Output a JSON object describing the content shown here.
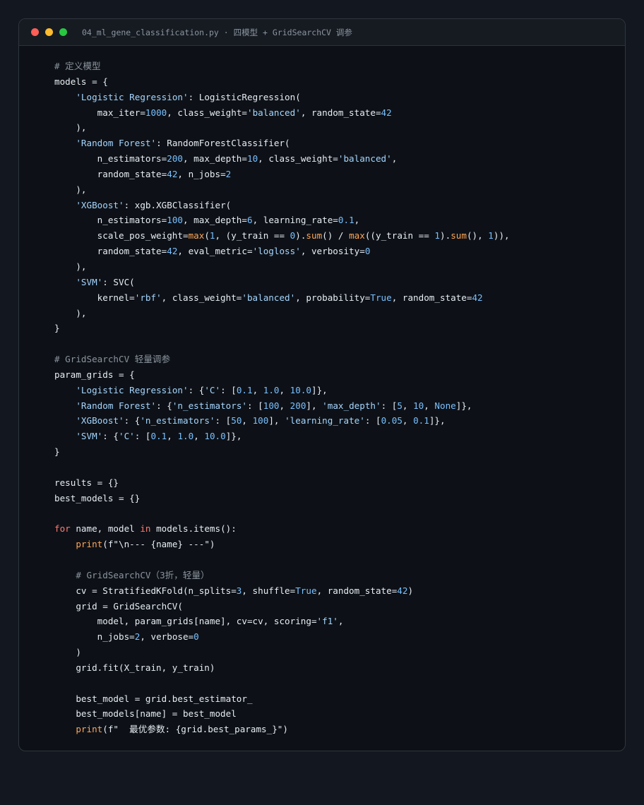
{
  "window": {
    "title": "04_ml_gene_classification.py · 四模型 + GridSearchCV 调参"
  },
  "colors": {
    "page_background": "#131720",
    "editor_background": "#0d1117",
    "titlebar_background": "#161b22",
    "comment": "#8b949e",
    "string": "#a5d6ff",
    "number": "#79c0ff",
    "keyword": "#ff7b72",
    "builtin_function": "#ffa657",
    "default_text": "#e6edf3",
    "close_dot": "#ff5f57",
    "minimize_dot": "#febc2e",
    "zoom_dot": "#28c840"
  },
  "code_lines": [
    [
      [
        "com",
        "# 定义模型"
      ]
    ],
    [
      [
        "def",
        "models = {"
      ]
    ],
    [
      [
        "def",
        "    "
      ],
      [
        "str",
        "'Logistic Regression'"
      ],
      [
        "def",
        ": LogisticRegression("
      ]
    ],
    [
      [
        "def",
        "        max_iter="
      ],
      [
        "num",
        "1000"
      ],
      [
        "def",
        ", class_weight="
      ],
      [
        "str",
        "'balanced'"
      ],
      [
        "def",
        ", random_state="
      ],
      [
        "num",
        "42"
      ]
    ],
    [
      [
        "def",
        "    ),"
      ]
    ],
    [
      [
        "def",
        "    "
      ],
      [
        "str",
        "'Random Forest'"
      ],
      [
        "def",
        ": RandomForestClassifier("
      ]
    ],
    [
      [
        "def",
        "        n_estimators="
      ],
      [
        "num",
        "200"
      ],
      [
        "def",
        ", max_depth="
      ],
      [
        "num",
        "10"
      ],
      [
        "def",
        ", class_weight="
      ],
      [
        "str",
        "'balanced'"
      ],
      [
        "def",
        ","
      ]
    ],
    [
      [
        "def",
        "        random_state="
      ],
      [
        "num",
        "42"
      ],
      [
        "def",
        ", n_jobs="
      ],
      [
        "num",
        "2"
      ]
    ],
    [
      [
        "def",
        "    ),"
      ]
    ],
    [
      [
        "def",
        "    "
      ],
      [
        "str",
        "'XGBoost'"
      ],
      [
        "def",
        ": xgb.XGBClassifier("
      ]
    ],
    [
      [
        "def",
        "        n_estimators="
      ],
      [
        "num",
        "100"
      ],
      [
        "def",
        ", max_depth="
      ],
      [
        "num",
        "6"
      ],
      [
        "def",
        ", learning_rate="
      ],
      [
        "num",
        "0.1"
      ],
      [
        "def",
        ","
      ]
    ],
    [
      [
        "def",
        "        scale_pos_weight="
      ],
      [
        "fn",
        "max"
      ],
      [
        "def",
        "("
      ],
      [
        "num",
        "1"
      ],
      [
        "def",
        ", (y_train == "
      ],
      [
        "num",
        "0"
      ],
      [
        "def",
        ")."
      ],
      [
        "fn",
        "sum"
      ],
      [
        "def",
        "() / "
      ],
      [
        "fn",
        "max"
      ],
      [
        "def",
        "((y_train == "
      ],
      [
        "num",
        "1"
      ],
      [
        "def",
        ")."
      ],
      [
        "fn",
        "sum"
      ],
      [
        "def",
        "(), "
      ],
      [
        "num",
        "1"
      ],
      [
        "def",
        ")),"
      ]
    ],
    [
      [
        "def",
        "        random_state="
      ],
      [
        "num",
        "42"
      ],
      [
        "def",
        ", eval_metric="
      ],
      [
        "str",
        "'logloss'"
      ],
      [
        "def",
        ", verbosity="
      ],
      [
        "num",
        "0"
      ]
    ],
    [
      [
        "def",
        "    ),"
      ]
    ],
    [
      [
        "def",
        "    "
      ],
      [
        "str",
        "'SVM'"
      ],
      [
        "def",
        ": SVC("
      ]
    ],
    [
      [
        "def",
        "        kernel="
      ],
      [
        "str",
        "'rbf'"
      ],
      [
        "def",
        ", class_weight="
      ],
      [
        "str",
        "'balanced'"
      ],
      [
        "def",
        ", probability="
      ],
      [
        "num",
        "True"
      ],
      [
        "def",
        ", random_state="
      ],
      [
        "num",
        "42"
      ]
    ],
    [
      [
        "def",
        "    ),"
      ]
    ],
    [
      [
        "def",
        "}"
      ]
    ],
    [],
    [
      [
        "com",
        "# GridSearchCV 轻量调参"
      ]
    ],
    [
      [
        "def",
        "param_grids = {"
      ]
    ],
    [
      [
        "def",
        "    "
      ],
      [
        "str",
        "'Logistic Regression'"
      ],
      [
        "def",
        ": {"
      ],
      [
        "str",
        "'C'"
      ],
      [
        "def",
        ": ["
      ],
      [
        "num",
        "0.1"
      ],
      [
        "def",
        ", "
      ],
      [
        "num",
        "1.0"
      ],
      [
        "def",
        ", "
      ],
      [
        "num",
        "10.0"
      ],
      [
        "def",
        "]},"
      ]
    ],
    [
      [
        "def",
        "    "
      ],
      [
        "str",
        "'Random Forest'"
      ],
      [
        "def",
        ": {"
      ],
      [
        "str",
        "'n_estimators'"
      ],
      [
        "def",
        ": ["
      ],
      [
        "num",
        "100"
      ],
      [
        "def",
        ", "
      ],
      [
        "num",
        "200"
      ],
      [
        "def",
        "], "
      ],
      [
        "str",
        "'max_depth'"
      ],
      [
        "def",
        ": ["
      ],
      [
        "num",
        "5"
      ],
      [
        "def",
        ", "
      ],
      [
        "num",
        "10"
      ],
      [
        "def",
        ", "
      ],
      [
        "num",
        "None"
      ],
      [
        "def",
        "]},"
      ]
    ],
    [
      [
        "def",
        "    "
      ],
      [
        "str",
        "'XGBoost'"
      ],
      [
        "def",
        ": {"
      ],
      [
        "str",
        "'n_estimators'"
      ],
      [
        "def",
        ": ["
      ],
      [
        "num",
        "50"
      ],
      [
        "def",
        ", "
      ],
      [
        "num",
        "100"
      ],
      [
        "def",
        "], "
      ],
      [
        "str",
        "'learning_rate'"
      ],
      [
        "def",
        ": ["
      ],
      [
        "num",
        "0.05"
      ],
      [
        "def",
        ", "
      ],
      [
        "num",
        "0.1"
      ],
      [
        "def",
        "]},"
      ]
    ],
    [
      [
        "def",
        "    "
      ],
      [
        "str",
        "'SVM'"
      ],
      [
        "def",
        ": {"
      ],
      [
        "str",
        "'C'"
      ],
      [
        "def",
        ": ["
      ],
      [
        "num",
        "0.1"
      ],
      [
        "def",
        ", "
      ],
      [
        "num",
        "1.0"
      ],
      [
        "def",
        ", "
      ],
      [
        "num",
        "10.0"
      ],
      [
        "def",
        "]},"
      ]
    ],
    [
      [
        "def",
        "}"
      ]
    ],
    [],
    [
      [
        "def",
        "results = {}"
      ]
    ],
    [
      [
        "def",
        "best_models = {}"
      ]
    ],
    [],
    [
      [
        "kw",
        "for"
      ],
      [
        "def",
        " name, model "
      ],
      [
        "kw",
        "in"
      ],
      [
        "def",
        " models.items():"
      ]
    ],
    [
      [
        "def",
        "    "
      ],
      [
        "fn",
        "print"
      ],
      [
        "def",
        "(f\"\\n--- {name} ---\")"
      ]
    ],
    [],
    [
      [
        "def",
        "    "
      ],
      [
        "com",
        "# GridSearchCV（3折，轻量）"
      ]
    ],
    [
      [
        "def",
        "    cv = StratifiedKFold(n_splits="
      ],
      [
        "num",
        "3"
      ],
      [
        "def",
        ", shuffle="
      ],
      [
        "num",
        "True"
      ],
      [
        "def",
        ", random_state="
      ],
      [
        "num",
        "42"
      ],
      [
        "def",
        ")"
      ]
    ],
    [
      [
        "def",
        "    grid = GridSearchCV("
      ]
    ],
    [
      [
        "def",
        "        model, param_grids[name], cv=cv, scoring="
      ],
      [
        "str",
        "'f1'"
      ],
      [
        "def",
        ","
      ]
    ],
    [
      [
        "def",
        "        n_jobs="
      ],
      [
        "num",
        "2"
      ],
      [
        "def",
        ", verbose="
      ],
      [
        "num",
        "0"
      ]
    ],
    [
      [
        "def",
        "    )"
      ]
    ],
    [
      [
        "def",
        "    grid.fit(X_train, y_train)"
      ]
    ],
    [],
    [
      [
        "def",
        "    best_model = grid.best_estimator_"
      ]
    ],
    [
      [
        "def",
        "    best_models[name] = best_model"
      ]
    ],
    [
      [
        "def",
        "    "
      ],
      [
        "fn",
        "print"
      ],
      [
        "def",
        "(f\"  最优参数: {grid.best_params_}\")"
      ]
    ]
  ]
}
